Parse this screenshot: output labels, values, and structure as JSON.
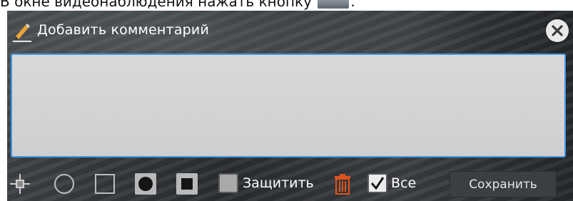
{
  "doc": {
    "instruction": "В окне видеонаблюдения нажать кнопку",
    "instruction_end": "."
  },
  "dialog": {
    "title": "Добавить комментарий",
    "comment_value": "",
    "close_icon": "close-icon"
  },
  "toolbar": {
    "tools": [
      {
        "name": "move-cross-icon"
      },
      {
        "name": "circle-outline-icon"
      },
      {
        "name": "square-outline-icon"
      },
      {
        "name": "circle-filled-icon"
      },
      {
        "name": "square-filled-icon"
      }
    ],
    "protect_label": "Защитить",
    "protect_checked": false,
    "trash_icon": "trash-icon",
    "all_label": "Все",
    "all_checked": true,
    "save_label": "Сохранить"
  },
  "colors": {
    "accent_border": "#3e97e6",
    "trash": "#e0521a",
    "panel_bg": "#2e3135"
  }
}
